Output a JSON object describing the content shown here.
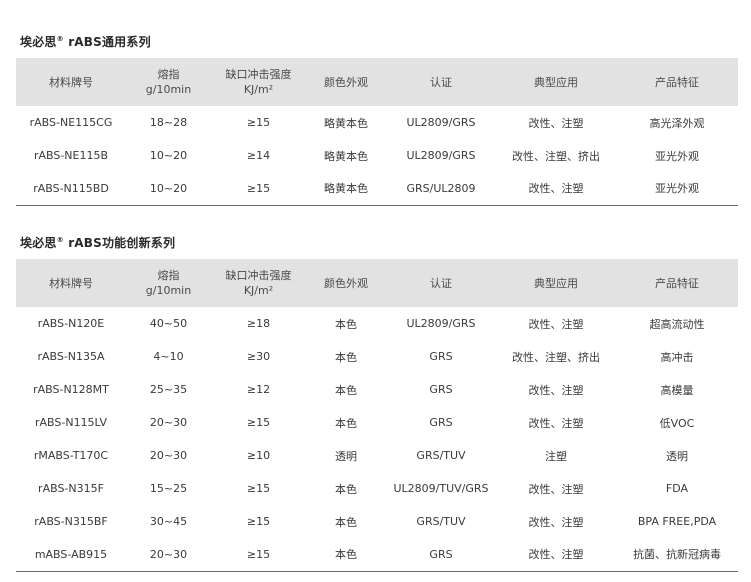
{
  "section1": {
    "title_prefix": "埃必思",
    "title_mark": "®",
    "title_suffix": " rABS通用系列",
    "headers": [
      "材料牌号",
      "熔指",
      "g/10min",
      "缺口冲击强度",
      "KJ/m²",
      "颜色外观",
      "认证",
      "典型应用",
      "产品特征"
    ],
    "rows": [
      [
        "rABS-NE115CG",
        "18~28",
        "≥15",
        "略黄本色",
        "UL2809/GRS",
        "改性、注塑",
        "高光泽外观"
      ],
      [
        "rABS-NE115B",
        "10~20",
        "≥14",
        "略黄本色",
        "UL2809/GRS",
        "改性、注塑、挤出",
        "亚光外观"
      ],
      [
        "rABS-N115BD",
        "10~20",
        "≥15",
        "略黄本色",
        "GRS/UL2809",
        "改性、注塑",
        "亚光外观"
      ]
    ]
  },
  "section2": {
    "title_prefix": "埃必思",
    "title_mark": "®",
    "title_suffix": " rABS功能创新系列",
    "headers": [
      "材料牌号",
      "熔指",
      "g/10min",
      "缺口冲击强度",
      "KJ/m²",
      "颜色外观",
      "认证",
      "典型应用",
      "产品特征"
    ],
    "rows": [
      [
        "rABS-N120E",
        "40~50",
        "≥18",
        "本色",
        "UL2809/GRS",
        "改性、注塑",
        "超高流动性"
      ],
      [
        "rABS-N135A",
        "4~10",
        "≥30",
        "本色",
        "GRS",
        "改性、注塑、挤出",
        "高冲击"
      ],
      [
        "rABS-N128MT",
        "25~35",
        "≥12",
        "本色",
        "GRS",
        "改性、注塑",
        "高模量"
      ],
      [
        "rABS-N115LV",
        "20~30",
        "≥15",
        "本色",
        "GRS",
        "改性、注塑",
        "低VOC"
      ],
      [
        "rMABS-T170C",
        "20~30",
        "≥10",
        "透明",
        "GRS/TUV",
        "注塑",
        "透明"
      ],
      [
        "rABS-N315F",
        "15~25",
        "≥15",
        "本色",
        "UL2809/TUV/GRS",
        "改性、注塑",
        "FDA"
      ],
      [
        "rABS-N315BF",
        "30~45",
        "≥15",
        "本色",
        "GRS/TUV",
        "改性、注塑",
        "BPA FREE,PDA"
      ],
      [
        "mABS-AB915",
        "20~30",
        "≥15",
        "本色",
        "GRS",
        "改性、注塑",
        "抗菌、抗新冠病毒"
      ]
    ]
  }
}
